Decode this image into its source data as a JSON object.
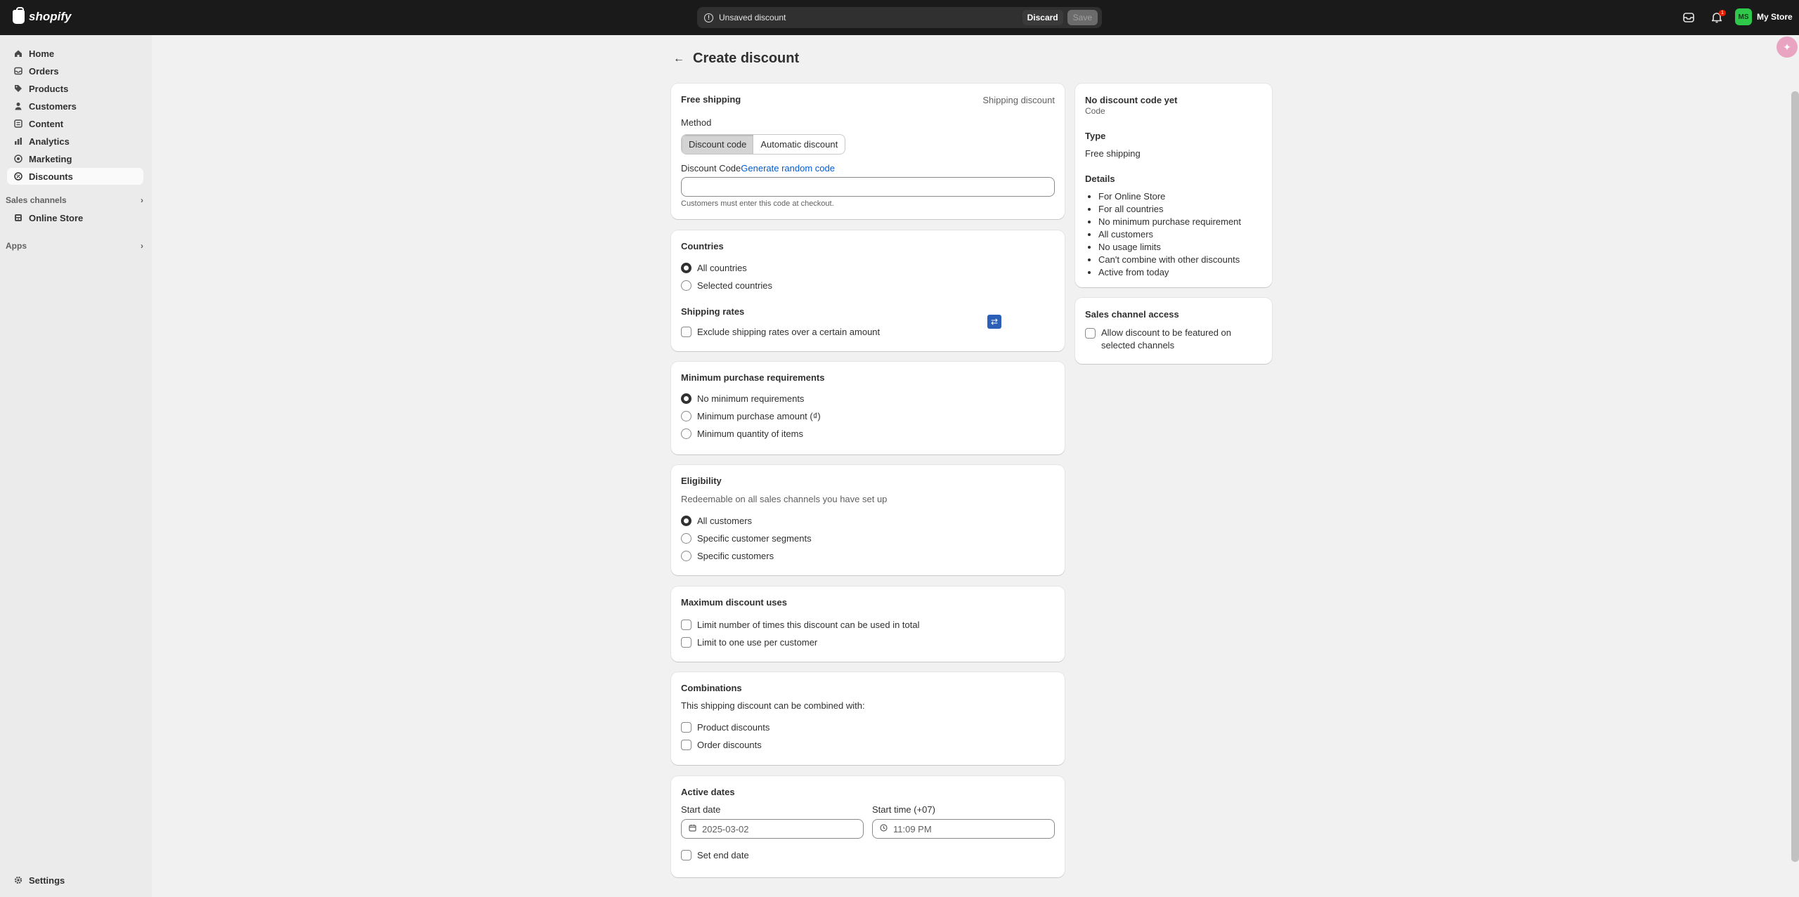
{
  "topbar": {
    "brand": "shopify",
    "savebar_message": "Unsaved discount",
    "discard_label": "Discard",
    "save_label": "Save",
    "notification_count": "1",
    "store_initials": "MS",
    "store_name": "My Store"
  },
  "sidebar": {
    "items": [
      {
        "label": "Home",
        "icon": "home-icon"
      },
      {
        "label": "Orders",
        "icon": "orders-icon"
      },
      {
        "label": "Products",
        "icon": "tag-icon"
      },
      {
        "label": "Customers",
        "icon": "person-icon"
      },
      {
        "label": "Content",
        "icon": "content-icon"
      },
      {
        "label": "Analytics",
        "icon": "analytics-icon"
      },
      {
        "label": "Marketing",
        "icon": "marketing-icon"
      },
      {
        "label": "Discounts",
        "icon": "discount-icon"
      }
    ],
    "sales_channels_label": "Sales channels",
    "online_store_label": "Online Store",
    "apps_label": "Apps",
    "settings_label": "Settings"
  },
  "page": {
    "title": "Create discount"
  },
  "method_card": {
    "title": "Free shipping",
    "type_label": "Shipping discount",
    "method_label": "Method",
    "method_options": [
      "Discount code",
      "Automatic discount"
    ],
    "code_label": "Discount Code",
    "generate_link": "Generate random code",
    "code_value": "",
    "help_text": "Customers must enter this code at checkout."
  },
  "countries_card": {
    "title": "Countries",
    "options": [
      "All countries",
      "Selected countries"
    ],
    "shipping_rates_title": "Shipping rates",
    "exclude_label": "Exclude shipping rates over a certain amount"
  },
  "min_req_card": {
    "title": "Minimum purchase requirements",
    "options": [
      "No minimum requirements",
      "Minimum purchase amount (₫)",
      "Minimum quantity of items"
    ]
  },
  "eligibility_card": {
    "title": "Eligibility",
    "subtitle": "Redeemable on all sales channels you have set up",
    "options": [
      "All customers",
      "Specific customer segments",
      "Specific customers"
    ]
  },
  "max_uses_card": {
    "title": "Maximum discount uses",
    "options": [
      "Limit number of times this discount can be used in total",
      "Limit to one use per customer"
    ]
  },
  "combinations_card": {
    "title": "Combinations",
    "subtitle": "This shipping discount can be combined with:",
    "options": [
      "Product discounts",
      "Order discounts"
    ]
  },
  "dates_card": {
    "title": "Active dates",
    "start_date_label": "Start date",
    "start_date_value": "2025-03-02",
    "start_time_label": "Start time (+07)",
    "start_time_value": "11:09 PM",
    "end_date_label": "Set end date"
  },
  "summary_card": {
    "code_title": "No discount code yet",
    "code_sub": "Code",
    "type_title": "Type",
    "type_value": "Free shipping",
    "details_title": "Details",
    "details": [
      "For Online Store",
      "For all countries",
      "No minimum purchase requirement",
      "All customers",
      "No usage limits",
      "Can't combine with other discounts",
      "Active from today"
    ]
  },
  "channel_card": {
    "title": "Sales channel access",
    "checkbox_label_1": "Allow discount to be featured on",
    "checkbox_label_2": "selected channels"
  }
}
